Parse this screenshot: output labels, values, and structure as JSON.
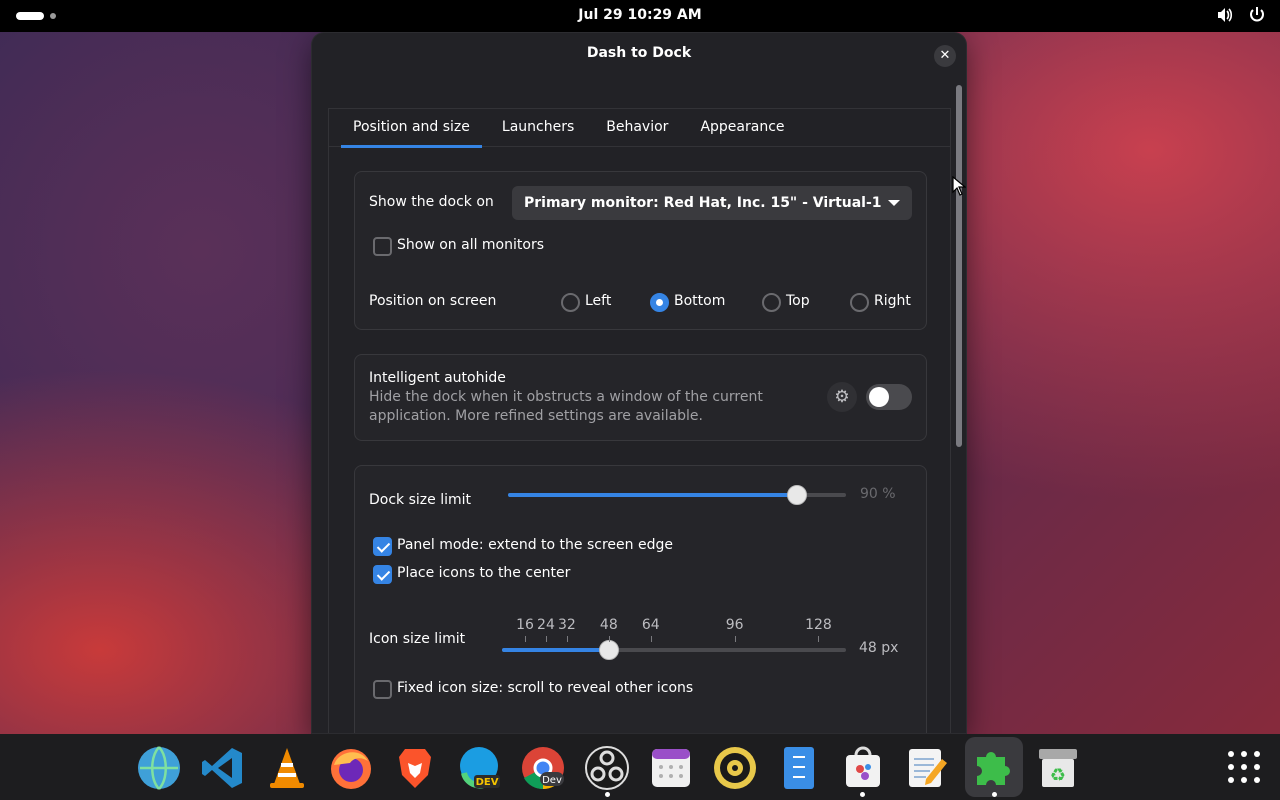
{
  "topbar": {
    "datetime": "Jul 29  10:29 AM",
    "icons": [
      "volume-icon",
      "power-icon"
    ]
  },
  "window": {
    "title": "Dash to Dock",
    "tabs": [
      "Position and size",
      "Launchers",
      "Behavior",
      "Appearance"
    ],
    "active_tab": "Position and size",
    "monitor": {
      "label": "Show the dock on",
      "selected": "Primary monitor: Red Hat, Inc. 15\" - Virtual-1",
      "all_monitors_label": "Show on all monitors",
      "all_monitors_checked": false
    },
    "position": {
      "label": "Position on screen",
      "options": [
        "Left",
        "Bottom",
        "Top",
        "Right"
      ],
      "selected": "Bottom"
    },
    "autohide": {
      "title": "Intelligent autohide",
      "desc_line1": "Hide the dock when it obstructs a window of the current",
      "desc_line2": "application. More refined settings are available.",
      "enabled": false
    },
    "size": {
      "dock_limit_label": "Dock size limit",
      "dock_limit_value": "90 %",
      "dock_limit_fraction": 0.9,
      "panel_mode_label": "Panel mode: extend to the screen edge",
      "panel_mode_checked": true,
      "center_label": "Place icons to the center",
      "center_checked": true,
      "icon_limit_label": "Icon size limit",
      "icon_marks": [
        "16",
        "24",
        "32",
        "48",
        "64",
        "96",
        "128"
      ],
      "icon_value": "48 px",
      "fixed_label": "Fixed icon size: scroll to reveal other icons",
      "fixed_checked": false
    }
  },
  "dock": {
    "apps": [
      "globe-browser",
      "vscode",
      "vlc",
      "firefox",
      "brave",
      "edge-dev",
      "chrome-dev",
      "obs",
      "calendar",
      "speaker",
      "file-manager",
      "software-store",
      "text-editor",
      "extensions",
      "trash"
    ],
    "apps_grid_icon": "show-apps-icon"
  },
  "colors": {
    "accent": "#3584e4",
    "window_bg": "#222226",
    "dock_bg": "#1d1d1f"
  }
}
